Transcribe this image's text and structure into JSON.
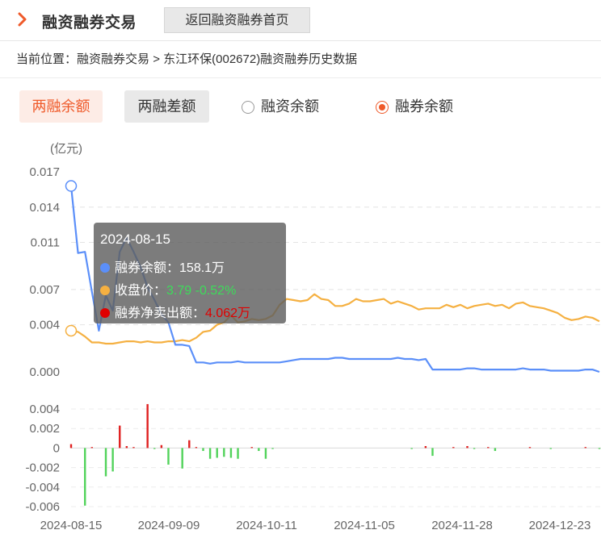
{
  "header": {
    "title": "融资融券交易",
    "back_label": "返回融资融券首页"
  },
  "breadcrumb": {
    "prefix": "当前位置：",
    "link": "融资融券交易",
    "sep": " > ",
    "current": "东江环保(002672)融资融券历史数据"
  },
  "tabs": [
    {
      "label": "两融余额",
      "active": true
    },
    {
      "label": "两融差额",
      "active": false
    }
  ],
  "radios": [
    {
      "label": "融资余额",
      "selected": false
    },
    {
      "label": "融券余额",
      "selected": true
    }
  ],
  "colors": {
    "balance": "#5b8ff9",
    "price": "#f5b041",
    "net_pos": "#e02020",
    "net_neg": "#52d35b",
    "accent": "#ef5a2a"
  },
  "tooltip": {
    "date": "2024-08-15",
    "rows": [
      {
        "label": "融券余额：",
        "value": "158.1万",
        "value2": "",
        "color": "#5b8ff9",
        "value_color": "#ffffff"
      },
      {
        "label": "收盘价：",
        "value": "3.79",
        "value2": "-0.52%",
        "color": "#f5b041",
        "value_color": "#3ddc5a"
      },
      {
        "label": "融券净卖出额：",
        "value": "4.062万",
        "value2": "",
        "color": "#e00000",
        "value_color": "#e00000"
      }
    ]
  },
  "chart_data": [
    {
      "type": "line",
      "ylabel": "(亿元)",
      "ylim": [
        0,
        0.017
      ],
      "yticks": [
        "0.017",
        "0.014",
        "0.011",
        "0.007",
        "0.004",
        "0.000"
      ],
      "grid": true,
      "x_tick_labels": [
        "2024-08-15",
        "2024-09-09",
        "2024-10-11",
        "2024-11-05",
        "2024-11-28",
        "2024-12-23"
      ],
      "series": [
        {
          "name": "融券余额",
          "values": [
            0.0158,
            0.0101,
            0.0102,
            0.0068,
            0.0035,
            0.0065,
            0.0052,
            0.0102,
            0.0114,
            0.0102,
            0.0089,
            0.0072,
            0.0061,
            0.0049,
            0.0042,
            0.0023,
            0.0023,
            0.0022,
            0.0008,
            0.0008,
            0.0007,
            0.0008,
            0.0008,
            0.0008,
            0.0009,
            0.0008,
            0.0008,
            0.0008,
            0.0008,
            0.0008,
            0.0008,
            0.0009,
            0.001,
            0.0011,
            0.0011,
            0.0011,
            0.0011,
            0.0011,
            0.0012,
            0.0012,
            0.0011,
            0.0011,
            0.0011,
            0.0011,
            0.0011,
            0.0011,
            0.0011,
            0.0012,
            0.0011,
            0.0011,
            0.001,
            0.0011,
            0.0002,
            0.0002,
            0.0002,
            0.0002,
            0.0002,
            0.0003,
            0.0003,
            0.0002,
            0.0002,
            0.0002,
            0.0002,
            0.0002,
            0.0002,
            0.0003,
            0.0002,
            0.0002,
            0.0002,
            0.0001,
            0.0001,
            0.0001,
            0.0001,
            0.0001,
            0.0002,
            0.0002,
            0.0
          ]
        },
        {
          "name": "收盘价",
          "values": [
            0.0035,
            0.0034,
            0.003,
            0.0025,
            0.0025,
            0.0024,
            0.0024,
            0.0025,
            0.0026,
            0.0026,
            0.0025,
            0.0026,
            0.0025,
            0.0025,
            0.0026,
            0.0026,
            0.0027,
            0.0026,
            0.0029,
            0.0034,
            0.0035,
            0.004,
            0.0042,
            0.0048,
            0.0042,
            0.0043,
            0.0045,
            0.0044,
            0.0045,
            0.0048,
            0.0057,
            0.0062,
            0.0061,
            0.006,
            0.0061,
            0.0066,
            0.0062,
            0.0061,
            0.0056,
            0.0056,
            0.0058,
            0.0062,
            0.006,
            0.006,
            0.0061,
            0.0062,
            0.0058,
            0.006,
            0.0058,
            0.0056,
            0.0053,
            0.0054,
            0.0054,
            0.0054,
            0.0057,
            0.0055,
            0.0057,
            0.0054,
            0.0056,
            0.0057,
            0.0058,
            0.0056,
            0.0057,
            0.0054,
            0.0058,
            0.0059,
            0.0056,
            0.0055,
            0.0054,
            0.0052,
            0.005,
            0.0046,
            0.0044,
            0.0045,
            0.0047,
            0.0046,
            0.0043
          ]
        }
      ]
    },
    {
      "type": "bar",
      "ylim": [
        -0.006,
        0.005
      ],
      "yticks": [
        "0.004",
        "0.002",
        "0",
        "-0.002",
        "-0.004",
        "-0.006"
      ],
      "series": [
        {
          "name": "融券净卖出额",
          "values": [
            0.0004,
            0.0,
            -0.0059,
            0.0001,
            0.0,
            -0.0029,
            -0.0024,
            0.0023,
            0.0002,
            0.0001,
            0.0,
            0.0045,
            -0.0001,
            0.0003,
            -0.0017,
            0.0,
            -0.0021,
            0.0008,
            0.0001,
            -0.0003,
            -0.0011,
            -0.001,
            -0.0009,
            -0.001,
            -0.0011,
            0.0,
            0.0001,
            -0.0003,
            -0.0011,
            -0.0001,
            0.0,
            0.0,
            0.0,
            0.0,
            0.0,
            0.0,
            0.0,
            0.0,
            0.0,
            0.0,
            0.0,
            0.0,
            0.0,
            0.0,
            0.0,
            0.0,
            0.0,
            0.0,
            0.0,
            -0.0001,
            0.0,
            0.0002,
            -0.0008,
            0.0,
            0.0,
            0.0001,
            0.0,
            0.0002,
            -0.0001,
            0.0,
            0.0001,
            -0.0003,
            0.0,
            0.0,
            0.0,
            0.0,
            0.0001,
            0.0,
            0.0,
            -0.0001,
            0.0,
            0.0,
            0.0,
            0.0,
            0.0001,
            0.0,
            -0.0001
          ]
        }
      ]
    }
  ]
}
